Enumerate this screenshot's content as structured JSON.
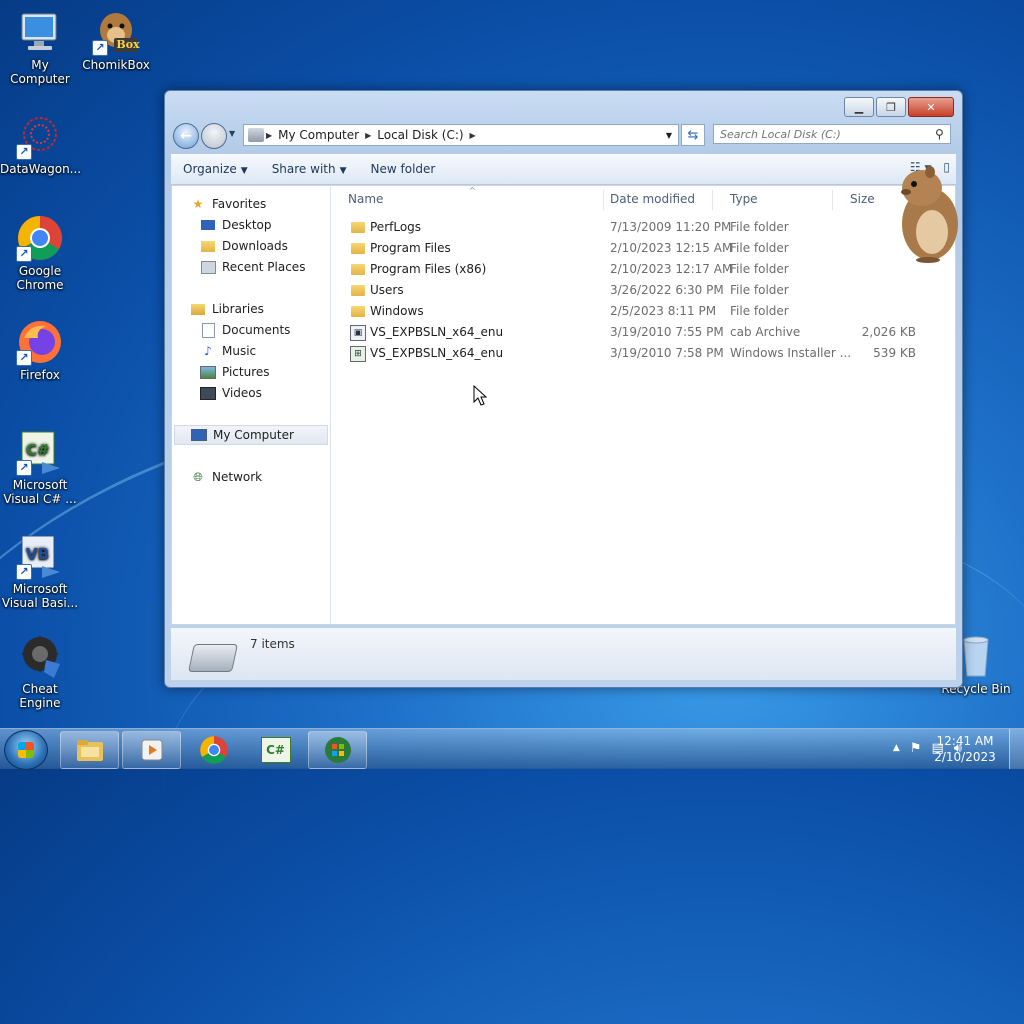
{
  "desktop": {
    "icons": [
      {
        "label": "My Computer"
      },
      {
        "label": "ChomikBox"
      },
      {
        "label": "DataWagon..."
      },
      {
        "label": "Google Chrome"
      },
      {
        "label": "Firefox"
      },
      {
        "label": "Microsoft Visual C# ..."
      },
      {
        "label": "Microsoft Visual Basi..."
      },
      {
        "label": "Cheat Engine"
      },
      {
        "label": "Recycle Bin"
      }
    ],
    "chomikbox_badge": "Box"
  },
  "window": {
    "breadcrumb": [
      "My Computer",
      "Local Disk (C:)"
    ],
    "search_placeholder": "Search Local Disk (C:)",
    "toolbar": {
      "organize": "Organize",
      "share_with": "Share with",
      "new_folder": "New folder"
    },
    "nav": {
      "favorites": "Favorites",
      "desktop": "Desktop",
      "downloads": "Downloads",
      "recent_places": "Recent Places",
      "libraries": "Libraries",
      "documents": "Documents",
      "music": "Music",
      "pictures": "Pictures",
      "videos": "Videos",
      "my_computer": "My Computer",
      "network": "Network"
    },
    "columns": {
      "name": "Name",
      "date_modified": "Date modified",
      "type": "Type",
      "size": "Size"
    },
    "files": [
      {
        "name": "PerfLogs",
        "date": "7/13/2009 11:20 PM",
        "type": "File folder",
        "size": ""
      },
      {
        "name": "Program Files",
        "date": "2/10/2023 12:15 AM",
        "type": "File folder",
        "size": ""
      },
      {
        "name": "Program Files (x86)",
        "date": "2/10/2023 12:17 AM",
        "type": "File folder",
        "size": ""
      },
      {
        "name": "Users",
        "date": "3/26/2022 6:30 PM",
        "type": "File folder",
        "size": ""
      },
      {
        "name": "Windows",
        "date": "2/5/2023 8:11 PM",
        "type": "File folder",
        "size": ""
      },
      {
        "name": "VS_EXPBSLN_x64_enu",
        "date": "3/19/2010 7:55 PM",
        "type": "cab Archive",
        "size": "2,026 KB"
      },
      {
        "name": "VS_EXPBSLN_x64_enu",
        "date": "3/19/2010 7:58 PM",
        "type": "Windows Installer ...",
        "size": "539 KB"
      }
    ],
    "status": "7 items"
  },
  "taskbar": {
    "time": "12:41 AM",
    "date": "2/10/2023",
    "csharp_label": "C#"
  }
}
